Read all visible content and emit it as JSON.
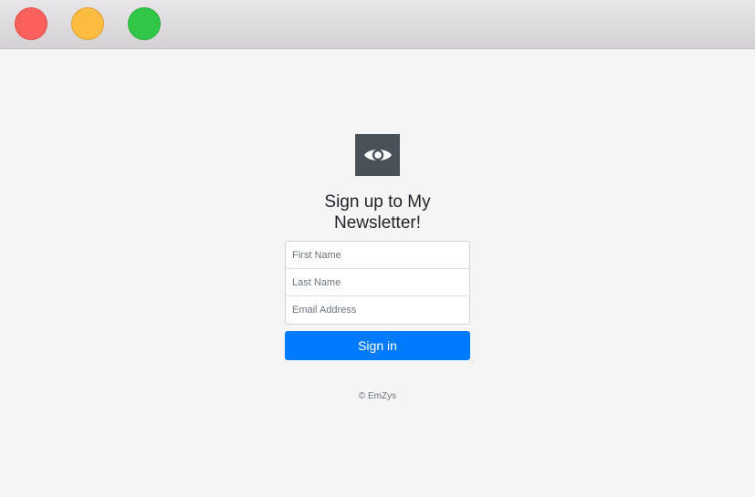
{
  "window": {
    "controls": [
      "close",
      "minimize",
      "zoom"
    ]
  },
  "logo": {
    "icon": "eye-icon",
    "background": "#4a5058"
  },
  "form": {
    "heading": "Sign up to My Newsletter!",
    "first_name_placeholder": "First Name",
    "last_name_placeholder": "Last Name",
    "email_placeholder": "Email Address",
    "submit_label": "Sign in"
  },
  "footer": {
    "copyright": "© EmZys"
  },
  "colors": {
    "accent": "#007bff",
    "background": "#f5f5f5"
  }
}
